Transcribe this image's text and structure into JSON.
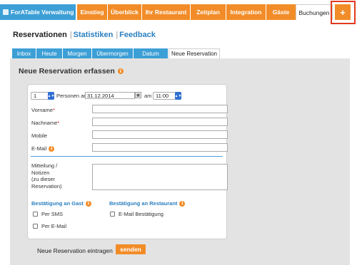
{
  "nav": {
    "brand": "ForATable Verwaltung",
    "tabs": [
      "Einstieg",
      "Überblick",
      "Ihr Restaurant",
      "Zeitplan",
      "Integration",
      "Gäste",
      "Buchungen"
    ],
    "active_tab": "Buchungen",
    "plus_label": "+"
  },
  "sublinks": {
    "current": "Reservationen",
    "items": [
      "Statistiken",
      "Feedback"
    ],
    "separator": "|"
  },
  "tabs": {
    "items": [
      "Inbox",
      "Heute",
      "Morgen",
      "Übermorgen",
      "Datum",
      "Neue Reservation"
    ],
    "active": "Neue Reservation"
  },
  "form": {
    "title": "Neue Reservation erfassen",
    "persons_value": "1",
    "persons_label": "Personen am",
    "date_value": "31.12.2014",
    "time_prefix": "am",
    "time_value": "11:00",
    "fields": {
      "vorname": "Vorname",
      "nachname": "Nachname",
      "mobile": "Mobile",
      "email": "E-Mail"
    },
    "required_mark": "*",
    "notes_label": [
      "Mitteilung /",
      "Notizen",
      "(zu dieser",
      "Reservation)"
    ],
    "guest_confirm": {
      "title": "Bestätigung an Gast",
      "options": [
        "Per SMS",
        "Per E-Mail"
      ]
    },
    "restaurant_confirm": {
      "title": "Bestätigung an Restaurant",
      "options": [
        "E-Mail Bestätigung"
      ]
    }
  },
  "footer": {
    "label": "Neue Reservation eintragen",
    "send": "senden"
  },
  "colors": {
    "orange": "#f28c28",
    "blue": "#3c9fd6",
    "highlight": "#e23a1d"
  }
}
